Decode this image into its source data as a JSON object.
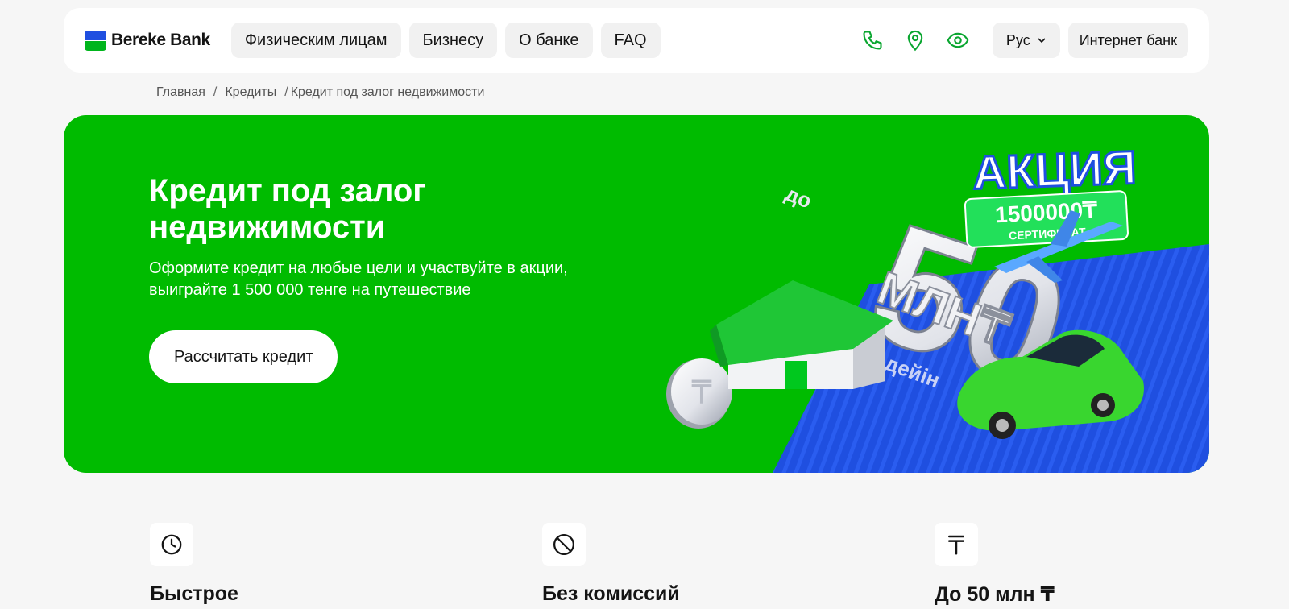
{
  "header": {
    "logo_text": "Bereke Bank",
    "nav": [
      "Физическим лицам",
      "Бизнесу",
      "О банке",
      "FAQ"
    ],
    "icons": [
      "phone-icon",
      "location-pin-icon",
      "eye-icon"
    ],
    "language": "Рус",
    "internet_bank": "Интернет банк"
  },
  "breadcrumb": [
    "Главная",
    "Кредиты",
    "Кредит под залог недвижимости"
  ],
  "hero": {
    "title_line1": "Кредит под залог",
    "title_line2": "недвижимости",
    "subtitle_line1": "Оформите кредит на любые цели и участвуйте в акции,",
    "subtitle_line2": "выиграйте 1 500 000 тенге на путешествие",
    "button": "Рассчитать кредит",
    "promo": {
      "badge": "АКЦИЯ",
      "amount": "1500000₸",
      "certificate": "СЕРТИФИКАТ",
      "prefix": "до",
      "big_number": "50",
      "unit": "МЛН₸",
      "suffix": "дейін"
    }
  },
  "features": [
    {
      "icon": "clock-icon",
      "title": "Быстрое"
    },
    {
      "icon": "no-symbol-icon",
      "title": "Без комиссий"
    },
    {
      "icon": "tenge-icon",
      "title": "До 50 млн ₸"
    }
  ],
  "colors": {
    "brand_green": "#00bb00",
    "brand_blue": "#1f4fe0",
    "icon_green": "#0aa630"
  }
}
